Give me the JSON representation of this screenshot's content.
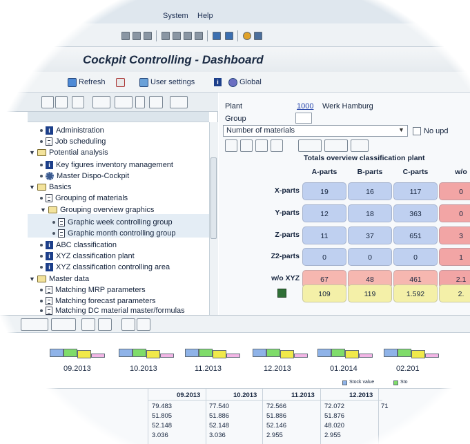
{
  "menu": {
    "items": [
      "System",
      "Help"
    ]
  },
  "title": "Cockpit Controlling - Dashboard",
  "toolbar2": {
    "refresh": "Refresh",
    "user_settings": "User settings",
    "global": "Global"
  },
  "tree": {
    "items": [
      {
        "label": "Administration",
        "icon": "info-icon"
      },
      {
        "label": "Job scheduling",
        "icon": "document-icon"
      },
      {
        "label": "Potential analysis",
        "icon": "folder-icon"
      },
      {
        "label": "Key figures inventory management",
        "icon": "info-icon"
      },
      {
        "label": "Master Dispo-Cockpit",
        "icon": "gear-icon"
      },
      {
        "label": "Basics",
        "icon": "folder-icon"
      },
      {
        "label": "Grouping of materials",
        "icon": "document-icon"
      },
      {
        "label": "Grouping overview graphics",
        "icon": "folder-icon"
      },
      {
        "label": "Graphic week controlling group",
        "icon": "document-icon"
      },
      {
        "label": "Graphic month controlling group",
        "icon": "document-icon"
      },
      {
        "label": "ABC classification",
        "icon": "info-icon"
      },
      {
        "label": "XYZ classification plant",
        "icon": "info-icon"
      },
      {
        "label": "XYZ classification controlling area",
        "icon": "info-icon"
      },
      {
        "label": "Master data",
        "icon": "folder-icon"
      },
      {
        "label": "Matching MRP parameters",
        "icon": "document-icon"
      },
      {
        "label": "Matching forecast parameters",
        "icon": "document-icon"
      },
      {
        "label": "Matching DC material master/formulas",
        "icon": "document-icon"
      }
    ]
  },
  "form": {
    "plant_label": "Plant",
    "plant_value": "1000",
    "plant_name": "Werk Hamburg",
    "group_label": "Group",
    "group_value": "",
    "selection": "Number of materials",
    "no_update_label": "No upd"
  },
  "table": {
    "title": "Totals overview classification plant",
    "columns": [
      "A-parts",
      "B-parts",
      "C-parts",
      "w/o"
    ],
    "rows": [
      {
        "label": "X-parts",
        "cells": [
          "19",
          "16",
          "117",
          "0"
        ]
      },
      {
        "label": "Y-parts",
        "cells": [
          "12",
          "18",
          "363",
          "0"
        ]
      },
      {
        "label": "Z-parts",
        "cells": [
          "11",
          "37",
          "651",
          "3"
        ]
      },
      {
        "label": "Z2-parts",
        "cells": [
          "0",
          "0",
          "0",
          "1"
        ]
      },
      {
        "label": "w/o XYZ",
        "cells": [
          "67",
          "48",
          "461",
          "2.1"
        ]
      },
      {
        "label": "",
        "cells": [
          "109",
          "119",
          "1.592",
          "2."
        ]
      }
    ]
  },
  "graphic": {
    "months": [
      "09.2013",
      "10.2013",
      "11.2013",
      "12.2013",
      "01.2014",
      "02.201"
    ],
    "legend": [
      "Stock value",
      "Sto"
    ]
  },
  "bottom_table": {
    "headers": [
      "09.2013",
      "10.2013",
      "11.2013",
      "12.2013"
    ],
    "rows": [
      [
        "79.483",
        "77.540",
        "72.566",
        "72.072"
      ],
      [
        "51.805",
        "51.886",
        "51.886",
        "51.876"
      ],
      [
        "52.148",
        "52.148",
        "52.146",
        "48.020"
      ],
      [
        "3.036",
        "3.036",
        "2.955",
        "2.955"
      ]
    ],
    "extra": "71"
  },
  "colors": {
    "cell_blue": "#bfd0f0",
    "cell_red": "#f2a5a5",
    "cell_yellow": "#f4f0a8",
    "bar_blue": "#8fb3e8",
    "bar_green": "#7fdc6a",
    "bar_yellow": "#f0e94a",
    "bar_pink": "#f3b6e6"
  }
}
